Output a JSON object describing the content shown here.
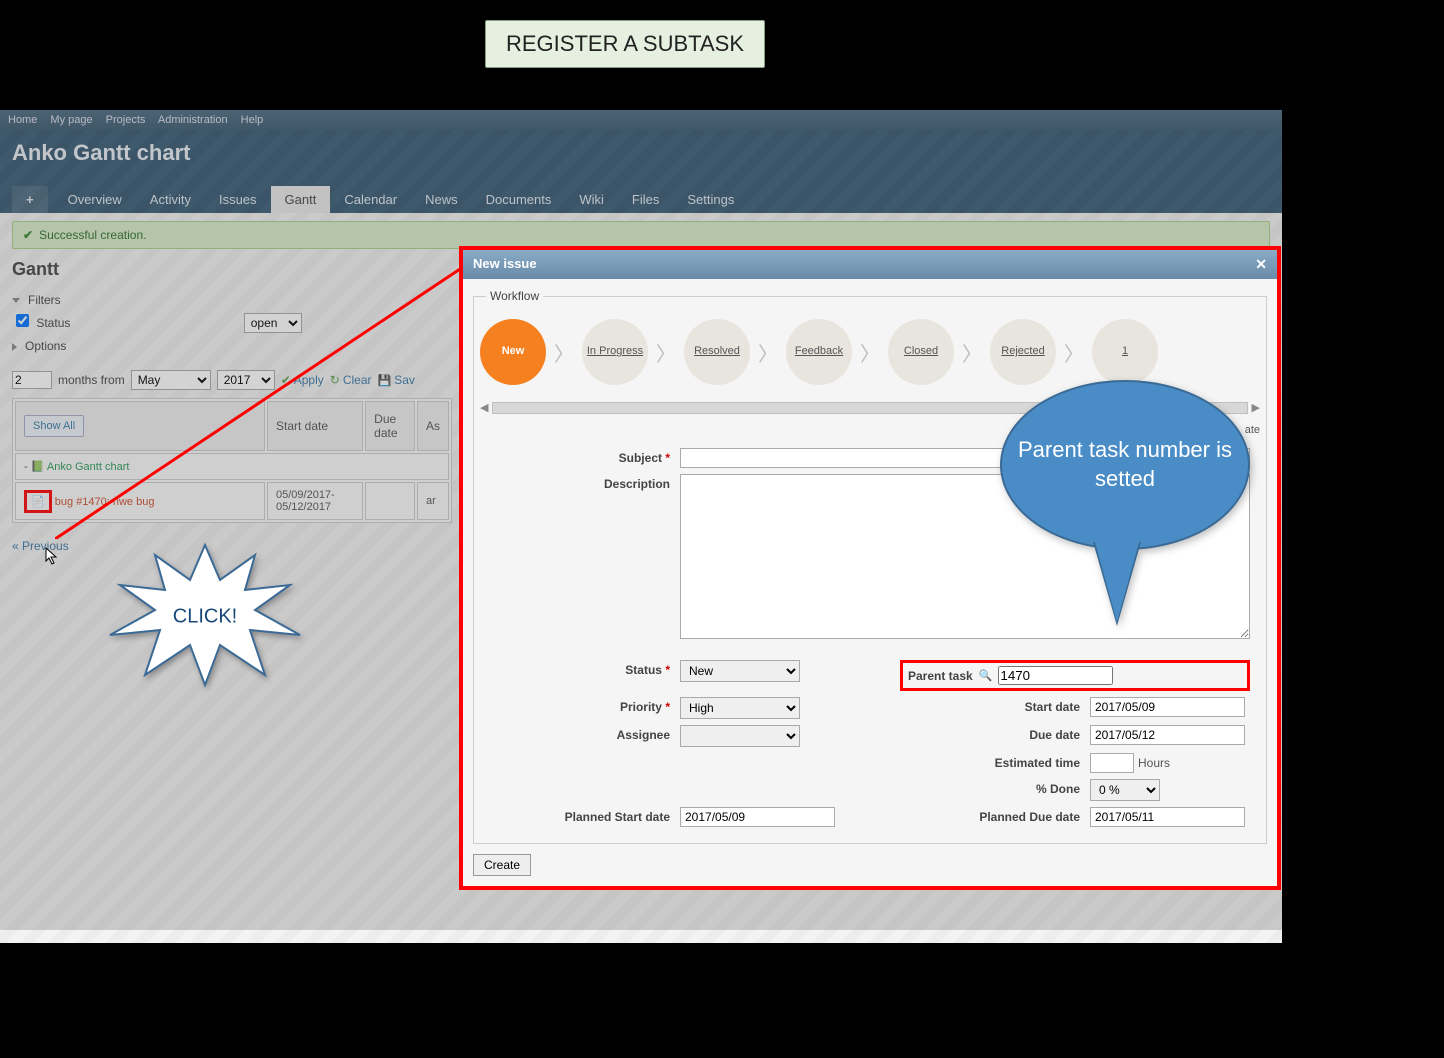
{
  "annotations": {
    "title_callout": "REGISTER A SUBTASK",
    "click_burst": "CLICK!",
    "speech_bubble": "Parent task number is setted"
  },
  "topbar": [
    "Home",
    "My page",
    "Projects",
    "Administration",
    "Help"
  ],
  "header": {
    "title": "Anko Gantt chart"
  },
  "tabs": {
    "plus": "+",
    "items": [
      "Overview",
      "Activity",
      "Issues",
      "Gantt",
      "Calendar",
      "News",
      "Documents",
      "Wiki",
      "Files",
      "Settings"
    ],
    "active": "Gantt"
  },
  "flash": "Successful creation.",
  "page_title": "Gantt",
  "filters": {
    "label": "Filters",
    "status_label": "Status",
    "status_checked": true,
    "status_op": "open",
    "options_label": "Options"
  },
  "controls": {
    "months_value": "2",
    "months_from": "months from",
    "month": "May",
    "year": "2017",
    "apply": "Apply",
    "clear": "Clear",
    "save": "Sav"
  },
  "gantt_table": {
    "show_all": "Show All",
    "cols": [
      "Start date",
      "Due date",
      "As"
    ],
    "project": "Anko Gantt chart",
    "issue": "bug #1470: nwe bug",
    "dates": "05/09/2017- 05/12/2017",
    "assignee_cell": "ar"
  },
  "previous": "« Previous",
  "dialog": {
    "title": "New issue",
    "workflow_legend": "Workflow",
    "workflow_steps": [
      "New",
      "In Progress",
      "Resolved",
      "Feedback",
      "Closed",
      "Rejected",
      "1"
    ],
    "private_label": "ate",
    "labels": {
      "subject": "Subject",
      "description": "Description",
      "status": "Status",
      "priority": "Priority",
      "assignee": "Assignee",
      "parent": "Parent task",
      "start": "Start date",
      "due": "Due date",
      "estimated": "Estimated time",
      "hours": "Hours",
      "pct": "% Done",
      "pstart": "Planned Start date",
      "pdue": "Planned Due date"
    },
    "values": {
      "subject": "",
      "description": "",
      "status": "New",
      "priority": "High",
      "assignee": "",
      "parent": "1470",
      "start": "2017/05/09",
      "due": "2017/05/12",
      "estimated": "",
      "pct": "0 %",
      "pstart": "2017/05/09",
      "pdue": "2017/05/11"
    },
    "create": "Create"
  }
}
